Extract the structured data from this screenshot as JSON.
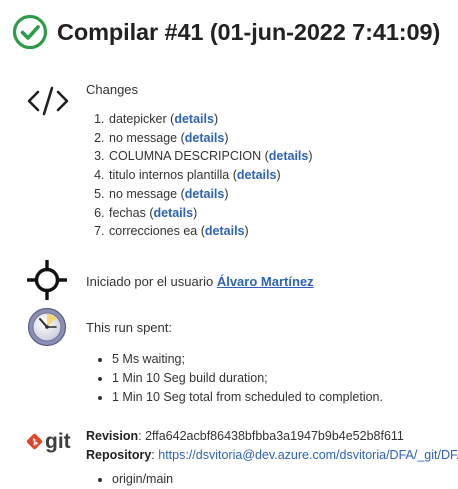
{
  "build": {
    "title": "Compilar #41 (01-jun-2022 7:41:09)",
    "status_icon": "check-circle-icon",
    "status_color": "#2e9b47"
  },
  "changes": {
    "label": "Changes",
    "icon": "code-icon",
    "items": [
      {
        "text": "datepicker",
        "link": "details"
      },
      {
        "text": "no message",
        "link": "details"
      },
      {
        "text": "COLUMNA DESCRIPCION",
        "link": "details"
      },
      {
        "text": "titulo internos plantilla",
        "link": "details"
      },
      {
        "text": "no message",
        "link": "details"
      },
      {
        "text": "fechas",
        "link": "details"
      },
      {
        "text": "correcciones ea",
        "link": "details"
      }
    ]
  },
  "started": {
    "icon": "commit-icon",
    "text": "Iniciado por el usuario",
    "user": "Álvaro Martínez"
  },
  "timing": {
    "icon": "clock-icon",
    "label": "This run spent:",
    "items": [
      "5 Ms waiting;",
      "1 Min 10 Seg build duration;",
      "1 Min 10 Seg total from scheduled to completion."
    ]
  },
  "git": {
    "icon": "git-logo",
    "logo_text": "git",
    "logo_color": "#e24329",
    "revision_label": "Revision",
    "revision": "2ffa642acbf86438bfbba3a1947b9b4e52b8f611",
    "repository_label": "Repository",
    "repository": "https://dsvitoria@dev.azure.com/dsvitoria/DFA/_git/DFA",
    "branches": [
      "origin/main"
    ]
  },
  "colors": {
    "link": "#2e63b6",
    "text": "#333333"
  }
}
